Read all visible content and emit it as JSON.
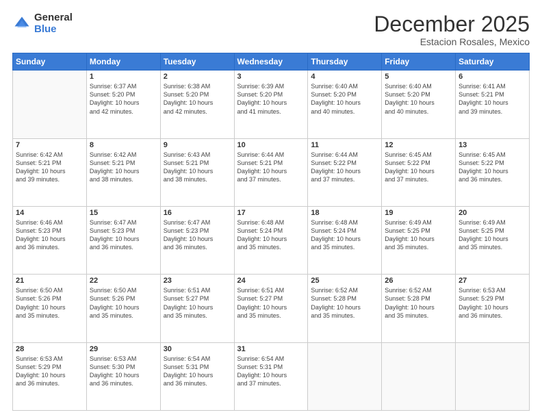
{
  "logo": {
    "general": "General",
    "blue": "Blue"
  },
  "header": {
    "month": "December 2025",
    "location": "Estacion Rosales, Mexico"
  },
  "days_of_week": [
    "Sunday",
    "Monday",
    "Tuesday",
    "Wednesday",
    "Thursday",
    "Friday",
    "Saturday"
  ],
  "weeks": [
    [
      {
        "day": "",
        "info": ""
      },
      {
        "day": "1",
        "info": "Sunrise: 6:37 AM\nSunset: 5:20 PM\nDaylight: 10 hours\nand 42 minutes."
      },
      {
        "day": "2",
        "info": "Sunrise: 6:38 AM\nSunset: 5:20 PM\nDaylight: 10 hours\nand 42 minutes."
      },
      {
        "day": "3",
        "info": "Sunrise: 6:39 AM\nSunset: 5:20 PM\nDaylight: 10 hours\nand 41 minutes."
      },
      {
        "day": "4",
        "info": "Sunrise: 6:40 AM\nSunset: 5:20 PM\nDaylight: 10 hours\nand 40 minutes."
      },
      {
        "day": "5",
        "info": "Sunrise: 6:40 AM\nSunset: 5:20 PM\nDaylight: 10 hours\nand 40 minutes."
      },
      {
        "day": "6",
        "info": "Sunrise: 6:41 AM\nSunset: 5:21 PM\nDaylight: 10 hours\nand 39 minutes."
      }
    ],
    [
      {
        "day": "7",
        "info": "Sunrise: 6:42 AM\nSunset: 5:21 PM\nDaylight: 10 hours\nand 39 minutes."
      },
      {
        "day": "8",
        "info": "Sunrise: 6:42 AM\nSunset: 5:21 PM\nDaylight: 10 hours\nand 38 minutes."
      },
      {
        "day": "9",
        "info": "Sunrise: 6:43 AM\nSunset: 5:21 PM\nDaylight: 10 hours\nand 38 minutes."
      },
      {
        "day": "10",
        "info": "Sunrise: 6:44 AM\nSunset: 5:21 PM\nDaylight: 10 hours\nand 37 minutes."
      },
      {
        "day": "11",
        "info": "Sunrise: 6:44 AM\nSunset: 5:22 PM\nDaylight: 10 hours\nand 37 minutes."
      },
      {
        "day": "12",
        "info": "Sunrise: 6:45 AM\nSunset: 5:22 PM\nDaylight: 10 hours\nand 37 minutes."
      },
      {
        "day": "13",
        "info": "Sunrise: 6:45 AM\nSunset: 5:22 PM\nDaylight: 10 hours\nand 36 minutes."
      }
    ],
    [
      {
        "day": "14",
        "info": "Sunrise: 6:46 AM\nSunset: 5:23 PM\nDaylight: 10 hours\nand 36 minutes."
      },
      {
        "day": "15",
        "info": "Sunrise: 6:47 AM\nSunset: 5:23 PM\nDaylight: 10 hours\nand 36 minutes."
      },
      {
        "day": "16",
        "info": "Sunrise: 6:47 AM\nSunset: 5:23 PM\nDaylight: 10 hours\nand 36 minutes."
      },
      {
        "day": "17",
        "info": "Sunrise: 6:48 AM\nSunset: 5:24 PM\nDaylight: 10 hours\nand 35 minutes."
      },
      {
        "day": "18",
        "info": "Sunrise: 6:48 AM\nSunset: 5:24 PM\nDaylight: 10 hours\nand 35 minutes."
      },
      {
        "day": "19",
        "info": "Sunrise: 6:49 AM\nSunset: 5:25 PM\nDaylight: 10 hours\nand 35 minutes."
      },
      {
        "day": "20",
        "info": "Sunrise: 6:49 AM\nSunset: 5:25 PM\nDaylight: 10 hours\nand 35 minutes."
      }
    ],
    [
      {
        "day": "21",
        "info": "Sunrise: 6:50 AM\nSunset: 5:26 PM\nDaylight: 10 hours\nand 35 minutes."
      },
      {
        "day": "22",
        "info": "Sunrise: 6:50 AM\nSunset: 5:26 PM\nDaylight: 10 hours\nand 35 minutes."
      },
      {
        "day": "23",
        "info": "Sunrise: 6:51 AM\nSunset: 5:27 PM\nDaylight: 10 hours\nand 35 minutes."
      },
      {
        "day": "24",
        "info": "Sunrise: 6:51 AM\nSunset: 5:27 PM\nDaylight: 10 hours\nand 35 minutes."
      },
      {
        "day": "25",
        "info": "Sunrise: 6:52 AM\nSunset: 5:28 PM\nDaylight: 10 hours\nand 35 minutes."
      },
      {
        "day": "26",
        "info": "Sunrise: 6:52 AM\nSunset: 5:28 PM\nDaylight: 10 hours\nand 35 minutes."
      },
      {
        "day": "27",
        "info": "Sunrise: 6:53 AM\nSunset: 5:29 PM\nDaylight: 10 hours\nand 36 minutes."
      }
    ],
    [
      {
        "day": "28",
        "info": "Sunrise: 6:53 AM\nSunset: 5:29 PM\nDaylight: 10 hours\nand 36 minutes."
      },
      {
        "day": "29",
        "info": "Sunrise: 6:53 AM\nSunset: 5:30 PM\nDaylight: 10 hours\nand 36 minutes."
      },
      {
        "day": "30",
        "info": "Sunrise: 6:54 AM\nSunset: 5:31 PM\nDaylight: 10 hours\nand 36 minutes."
      },
      {
        "day": "31",
        "info": "Sunrise: 6:54 AM\nSunset: 5:31 PM\nDaylight: 10 hours\nand 37 minutes."
      },
      {
        "day": "",
        "info": ""
      },
      {
        "day": "",
        "info": ""
      },
      {
        "day": "",
        "info": ""
      }
    ]
  ]
}
